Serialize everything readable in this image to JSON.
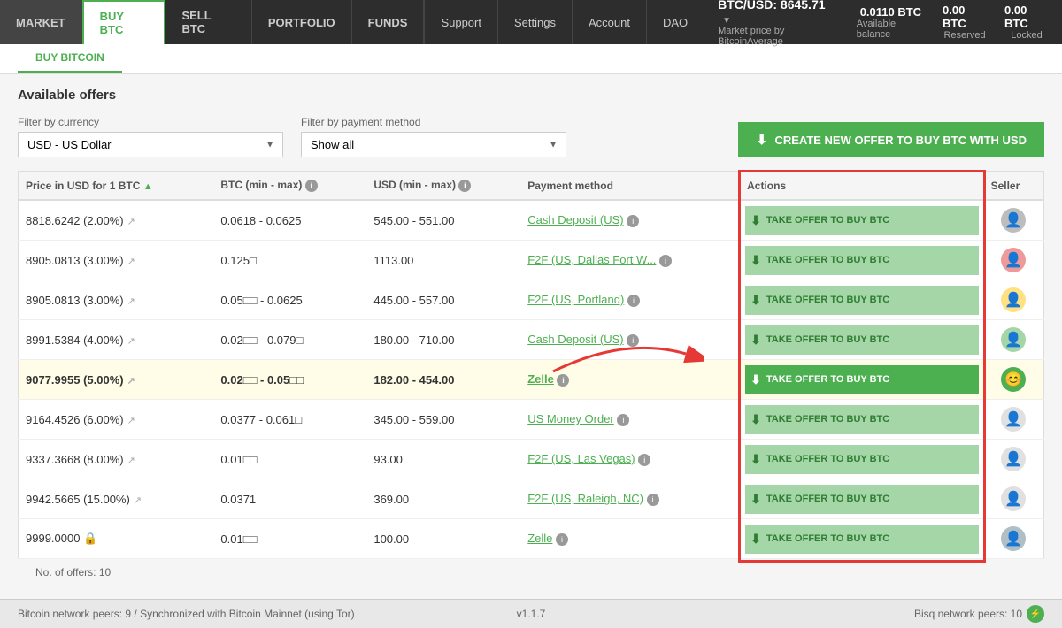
{
  "nav": {
    "items": [
      {
        "label": "MARKET",
        "active": false
      },
      {
        "label": "BUY BTC",
        "active": true
      },
      {
        "label": "SELL BTC",
        "active": false
      },
      {
        "label": "PORTFOLIO",
        "active": false
      },
      {
        "label": "FUNDS",
        "active": false
      }
    ],
    "right_items": [
      {
        "label": "Support"
      },
      {
        "label": "Settings"
      },
      {
        "label": "Account"
      },
      {
        "label": "DAO"
      }
    ],
    "price": {
      "label": "BTC/USD:",
      "value": "8645.71",
      "sub": "Market price by BitcoinAverage",
      "chevron": "▼"
    },
    "balance": {
      "available_value": "0.0110 BTC",
      "available_label": "Available balance",
      "reserved_value": "0.00 BTC",
      "reserved_label": "Reserved",
      "locked_value": "0.00 BTC",
      "locked_label": "Locked"
    }
  },
  "breadcrumb": "BUY BITCOIN",
  "section_title": "Available offers",
  "filters": {
    "currency_label": "Filter by currency",
    "currency_value": "USD  -  US Dollar",
    "payment_label": "Filter by payment method",
    "payment_value": "Show all"
  },
  "create_btn": "CREATE NEW OFFER TO BUY BTC WITH USD",
  "table": {
    "headers": [
      {
        "label": "Price in USD for 1 BTC",
        "sort": true
      },
      {
        "label": "BTC (min - max)",
        "info": true
      },
      {
        "label": "USD (min - max)",
        "info": true
      },
      {
        "label": "Payment method",
        "info": false
      },
      {
        "label": "Actions",
        "info": false
      },
      {
        "label": "Seller",
        "info": false
      }
    ],
    "rows": [
      {
        "price": "8818.6242 (2.00%)",
        "btc": "0.0618 - 0.0625",
        "usd": "545.00 - 551.00",
        "payment": "Cash Deposit (US)",
        "payment_info": true,
        "highlighted": false,
        "avatar_color": "#bdbdbd",
        "avatar_icon": "👤"
      },
      {
        "price": "8905.0813 (3.00%)",
        "btc": "0.125□",
        "usd": "1113.00",
        "payment": "F2F (US, Dallas Fort W...",
        "payment_info": true,
        "highlighted": false,
        "avatar_color": "#ef9a9a",
        "avatar_icon": "👤"
      },
      {
        "price": "8905.0813 (3.00%)",
        "btc": "0.05□□ - 0.0625",
        "usd": "445.00 - 557.00",
        "payment": "F2F (US, Portland)",
        "payment_info": true,
        "highlighted": false,
        "avatar_color": "#ffe082",
        "avatar_icon": "👤"
      },
      {
        "price": "8991.5384 (4.00%)",
        "btc": "0.02□□ - 0.079□",
        "usd": "180.00 - 710.00",
        "payment": "Cash Deposit (US)",
        "payment_info": true,
        "highlighted": false,
        "avatar_color": "#a5d6a7",
        "avatar_icon": "👤"
      },
      {
        "price": "9077.9955 (5.00%)",
        "btc": "0.02□□ - 0.05□□",
        "usd": "182.00 - 454.00",
        "payment": "Zelle",
        "payment_info": true,
        "highlighted": true,
        "avatar_color": "#4caf50",
        "avatar_icon": "😊"
      },
      {
        "price": "9164.4526 (6.00%)",
        "btc": "0.0377 - 0.061□",
        "usd": "345.00 - 559.00",
        "payment": "US Money Order",
        "payment_info": true,
        "highlighted": false,
        "avatar_color": "#e0e0e0",
        "avatar_icon": "👤"
      },
      {
        "price": "9337.3668 (8.00%)",
        "btc": "0.01□□",
        "usd": "93.00",
        "payment": "F2F (US, Las Vegas)",
        "payment_info": true,
        "highlighted": false,
        "avatar_color": "#e0e0e0",
        "avatar_icon": "👤"
      },
      {
        "price": "9942.5665 (15.00%)",
        "btc": "0.0371",
        "usd": "369.00",
        "payment": "F2F (US, Raleigh, NC)",
        "payment_info": true,
        "highlighted": false,
        "avatar_color": "#e0e0e0",
        "avatar_icon": "👤"
      },
      {
        "price": "9999.0000",
        "btc": "0.01□□",
        "usd": "100.00",
        "payment": "Zelle",
        "payment_info": true,
        "lock": true,
        "highlighted": false,
        "avatar_color": "#b0bec5",
        "avatar_icon": "👤"
      }
    ]
  },
  "take_btn_label": "TAKE OFFER TO BUY BTC",
  "offers_count": "No. of offers: 10",
  "status_bar": {
    "left": "Bitcoin network peers: 9 / Synchronized with Bitcoin Mainnet (using Tor)",
    "center": "v1.1.7",
    "right": "Bisq network peers: 10"
  }
}
